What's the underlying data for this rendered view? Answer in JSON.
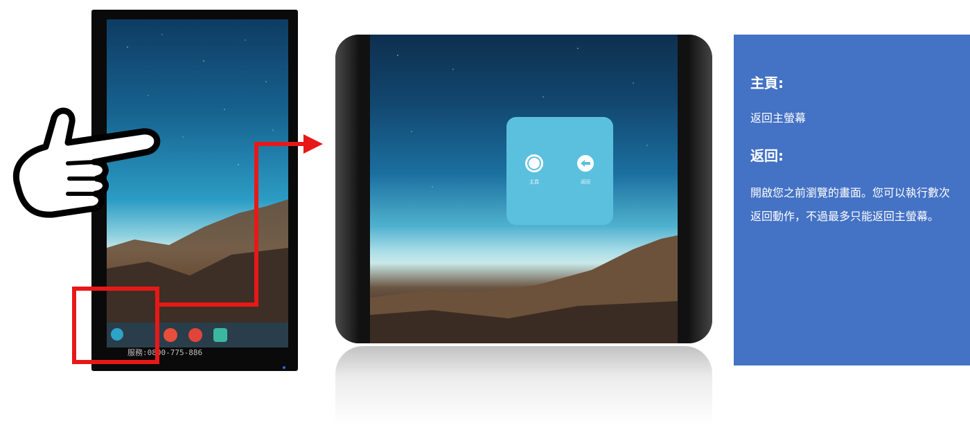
{
  "device": {
    "bezel_text": "服務:0800-775-886"
  },
  "popup": {
    "home_label": "主頁",
    "back_label": "返回",
    "home_icon": "home-circle-icon",
    "back_icon": "back-arrow-icon"
  },
  "panel": {
    "home_title": "主頁:",
    "home_desc": "返回主螢幕",
    "back_title": "返回:",
    "back_desc": "開啟您之前瀏覽的畫面。您可以執行數次返回動作，不過最多只能返回主螢幕。"
  },
  "colors": {
    "panel_bg": "#4472c4",
    "highlight": "#e81818",
    "popup_bg": "#5bc0dd"
  }
}
